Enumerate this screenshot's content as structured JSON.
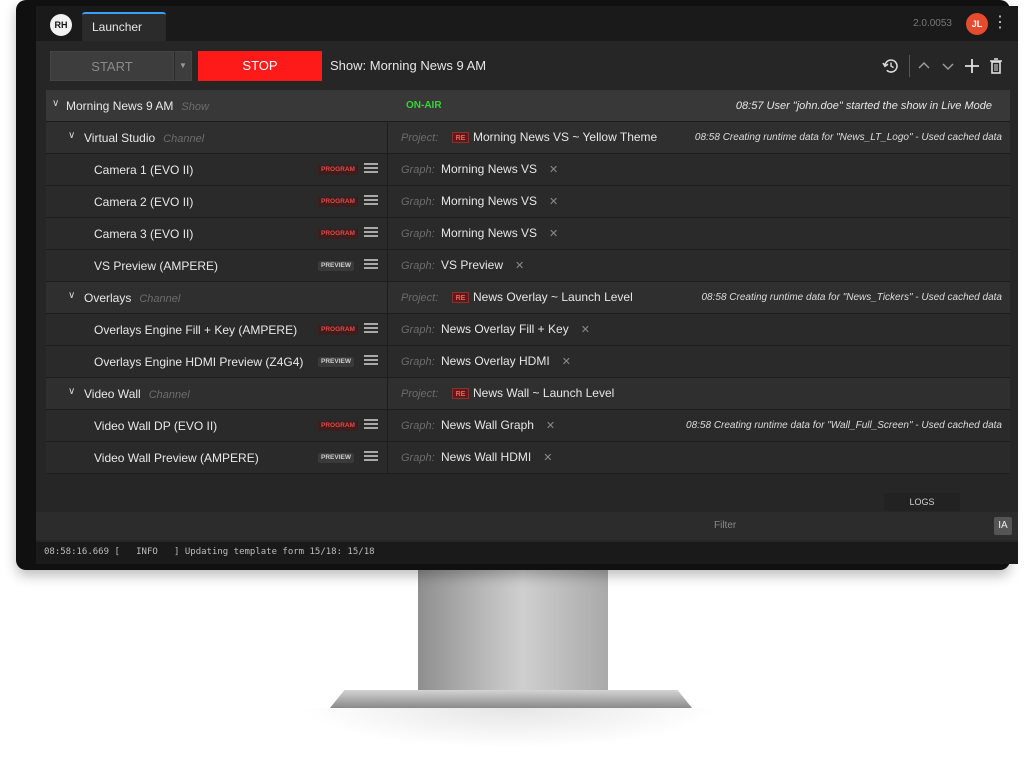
{
  "titlebar": {
    "logo": "RH",
    "tab_label": "Launcher",
    "version": "2.0.0053",
    "avatar": "JL"
  },
  "toolbar": {
    "start_label": "START",
    "stop_label": "STOP",
    "show_label": "Show: Morning News 9 AM",
    "icons": [
      "history-icon",
      "chevron-up-icon",
      "chevron-down-icon",
      "plus-icon",
      "trash-icon"
    ]
  },
  "show": {
    "name": "Morning News 9 AM",
    "type": "Show",
    "status": "ON-AIR",
    "message": "08:57 User \"john.doe\" started the show in Live Mode"
  },
  "channels": [
    {
      "name": "Virtual Studio",
      "type": "Channel",
      "project_label": "Project:",
      "project": "Morning News VS ~ Yellow Theme",
      "message": "08:58 Creating runtime data for \"News_LT_Logo\" - Used cached data",
      "engines": [
        {
          "name": "Camera 1 (EVO II)",
          "badge": "PROGRAM",
          "graph_label": "Graph:",
          "graph": "Morning News VS"
        },
        {
          "name": "Camera 2 (EVO II)",
          "badge": "PROGRAM",
          "graph_label": "Graph:",
          "graph": "Morning News VS"
        },
        {
          "name": "Camera 3 (EVO II)",
          "badge": "PROGRAM",
          "graph_label": "Graph:",
          "graph": "Morning News VS"
        },
        {
          "name": "VS Preview (AMPERE)",
          "badge": "PREVIEW",
          "graph_label": "Graph:",
          "graph": "VS Preview"
        }
      ]
    },
    {
      "name": "Overlays",
      "type": "Channel",
      "project_label": "Project:",
      "project": "News Overlay ~ Launch Level",
      "message": "08:58 Creating runtime data for \"News_Tickers\" - Used cached data",
      "engines": [
        {
          "name": "Overlays Engine Fill + Key  (AMPERE)",
          "badge": "PROGRAM",
          "graph_label": "Graph:",
          "graph": "News Overlay Fill + Key"
        },
        {
          "name": "Overlays Engine HDMI Preview (Z4G4)",
          "badge": "PREVIEW",
          "graph_label": "Graph:",
          "graph": "News Overlay HDMI"
        }
      ]
    },
    {
      "name": "Video Wall",
      "type": "Channel",
      "project_label": "Project:",
      "project": "News Wall ~ Launch Level",
      "message": "",
      "engines": [
        {
          "name": "Video Wall DP (EVO II)",
          "badge": "PROGRAM",
          "graph_label": "Graph:",
          "graph": "News Wall Graph",
          "message": "08:58 Creating runtime data for \"Wall_Full_Screen\" - Used cached data"
        },
        {
          "name": "Video Wall Preview  (AMPERE)",
          "badge": "PREVIEW",
          "graph_label": "Graph:",
          "graph": "News Wall HDMI"
        }
      ]
    }
  ],
  "logs": {
    "tab_label": "LOGS",
    "filter_placeholder": "Filter",
    "filter_button": "IA",
    "console_line": "08:58:16.669 [   INFO   ] Updating template form 15/18: 15/18"
  },
  "colors": {
    "stop": "#ff1a1a",
    "onair": "#35d435",
    "program_badge": "#e34848",
    "accent_tab": "#3aa0ff"
  }
}
